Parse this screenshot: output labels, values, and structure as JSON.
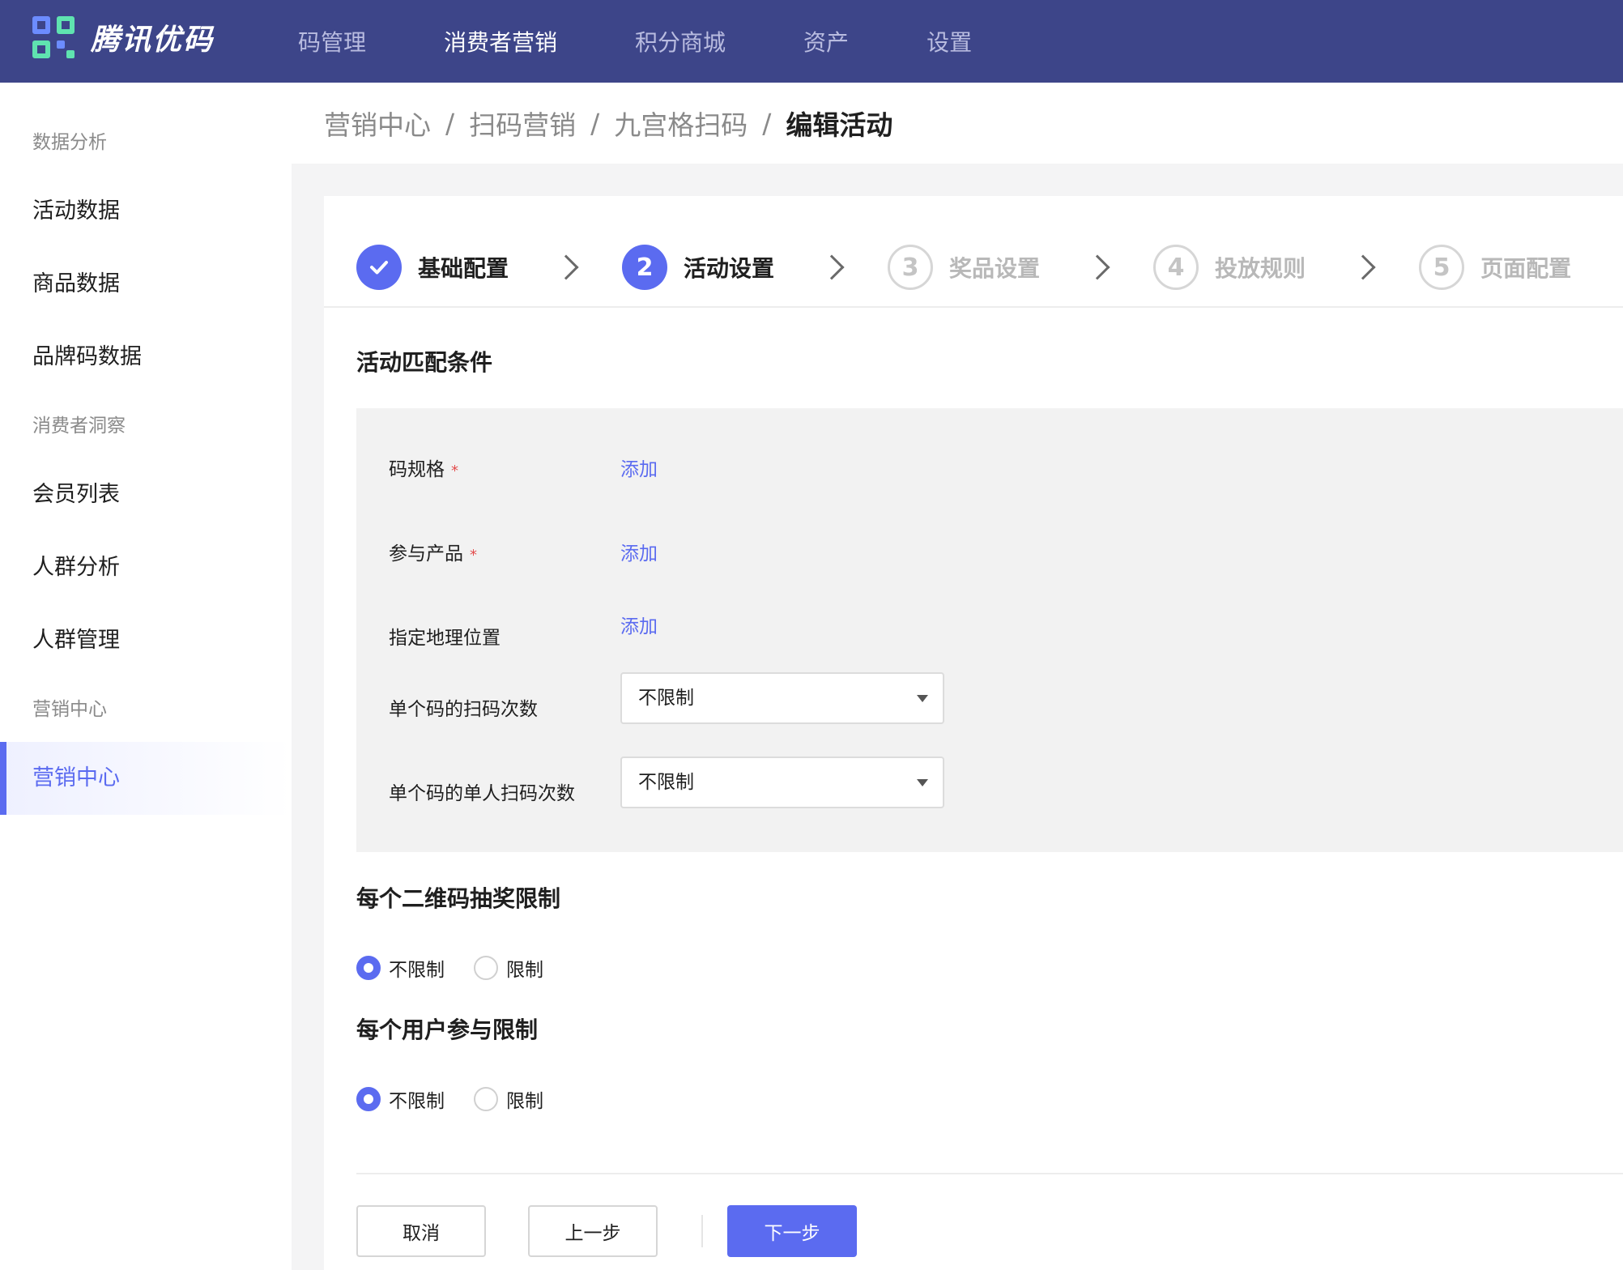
{
  "app": {
    "brand": "腾讯优码"
  },
  "topnav": {
    "items": [
      {
        "label": "码管理"
      },
      {
        "label": "消费者营销"
      },
      {
        "label": "积分商城"
      },
      {
        "label": "资产"
      },
      {
        "label": "设置"
      }
    ],
    "active_index": 1
  },
  "sidebar": {
    "group1": "数据分析",
    "group1_items": [
      "活动数据",
      "商品数据",
      "品牌码数据"
    ],
    "group2": "消费者洞察",
    "group2_items": [
      "会员列表",
      "人群分析",
      "人群管理"
    ],
    "group3": "营销中心",
    "group3_items": [
      "营销中心"
    ]
  },
  "breadcrumb": {
    "items": [
      "营销中心",
      "扫码营销",
      "九宫格扫码"
    ],
    "current": "编辑活动",
    "separator": "/"
  },
  "steps": [
    {
      "num": "✓",
      "label": "基础配置",
      "state": "done"
    },
    {
      "num": "2",
      "label": "活动设置",
      "state": "active"
    },
    {
      "num": "3",
      "label": "奖品设置",
      "state": "todo"
    },
    {
      "num": "4",
      "label": "投放规则",
      "state": "todo"
    },
    {
      "num": "5",
      "label": "页面配置",
      "state": "todo"
    }
  ],
  "match_section": {
    "title": "活动匹配条件",
    "code_spec": {
      "label": "码规格",
      "required_mark": "*",
      "action": "添加"
    },
    "products": {
      "label": "参与产品",
      "required_mark": "*",
      "action": "添加"
    },
    "geo": {
      "label": "指定地理位置",
      "action": "添加"
    },
    "scan_times": {
      "label": "单个码的扫码次数",
      "value": "不限制"
    },
    "per_user_scan_times": {
      "label": "单个码的单人扫码次数",
      "value": "不限制"
    }
  },
  "qr_limit": {
    "title": "每个二维码抽奖限制",
    "options": [
      "不限制",
      "限制"
    ],
    "selected": "不限制"
  },
  "user_limit": {
    "title": "每个用户参与限制",
    "options": [
      "不限制",
      "限制"
    ],
    "selected": "不限制"
  },
  "footer": {
    "cancel": "取消",
    "prev": "上一步",
    "next": "下一步"
  },
  "colors": {
    "topbar": "#3d4589",
    "primary": "#5b6bf0",
    "required": "#e34d4d",
    "content_bg": "#f4f4f5",
    "panel_bg": "#f2f2f2"
  }
}
